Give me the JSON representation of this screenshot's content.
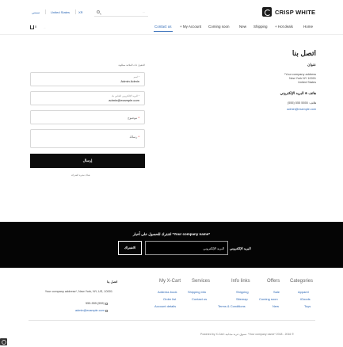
{
  "header": {
    "logo_text": "CRISP WHITE",
    "search_placeholder": "...",
    "links": [
      "سمتي",
      "United States",
      "XR"
    ]
  },
  "nav": {
    "items": [
      "Home",
      "Shipping",
      "New",
      "Coming soon",
      "My Account",
      "Hot deals",
      "Contact us"
    ],
    "cart_count": "0"
  },
  "contact": {
    "title": "اتصل بنا",
    "address_heading": "عنوان",
    "address_lines": [
      "*Your company address",
      "New York NY 10001",
      "United States"
    ],
    "phone_heading": "هاتف & البريد الإلكتروني",
    "phone": "هاتف: 5555 555 (555)",
    "email": "admin@example.com"
  },
  "form": {
    "intro": "الحقول ذات العلامة مطلوبة",
    "name_label": "اسم *",
    "name_value": "Admin Admin",
    "email_label": "البريد الإلكتروني الخاص بك *",
    "email_value": "admin@example.com",
    "subject_label": "موضوع",
    "message_label": "رسالة",
    "submit_label": "إرسال",
    "note": "هناك نشرة الشركة"
  },
  "newsletter": {
    "title": "اشترك للحصول على أخبار *Your company name*",
    "input_label": "البريد الإلكتروني",
    "input_placeholder": "البريد الإلكتروني",
    "button_label": "الاشتراك"
  },
  "footer": {
    "columns": [
      {
        "title": "Categories",
        "links": [
          "Apparel",
          "iGoods",
          "Toys"
        ]
      },
      {
        "title": "Offers",
        "links": [
          "Sale",
          "Coming soon",
          "New"
        ]
      },
      {
        "title": "Info links",
        "links": [
          "Shipping",
          "Sitemap",
          "Terms & Conditions"
        ]
      },
      {
        "title": "Services",
        "links": [
          "Shipping info",
          "Contact us"
        ]
      },
      {
        "title": "My X-Cart",
        "links": [
          "Address book",
          "Order list",
          "Account details"
        ]
      }
    ],
    "address_title": "اتصل بنا",
    "address_line": "Your company address*, New York, NY, US, 10001",
    "phone": "555-555 (555)",
    "email": "admin@example.com",
    "copyright": "Powered by X-Cart: تسوق عربة مجانية. *Your company name* 2018 - 2016 ©"
  }
}
